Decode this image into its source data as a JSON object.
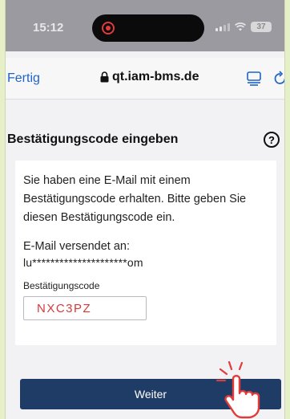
{
  "status_bar": {
    "time": "15:12",
    "battery": "37"
  },
  "browser": {
    "done_label": "Fertig",
    "url": "qt.iam-bms.de"
  },
  "section": {
    "title": "Bestätigungscode eingeben",
    "help_symbol": "?"
  },
  "card": {
    "info_text": "Sie haben eine E-Mail mit einem Bestätigungscode erhalten. Bitte geben Sie diesen Bestätigungscode ein.",
    "sent_label": "E-Mail versendet an:",
    "sent_email": "lu*********************om",
    "code_label": "Bestätigungscode",
    "code_value": "NXC3PZ"
  },
  "submit_label": "Weiter",
  "colors": {
    "accent_link": "#1f62c9",
    "button_bg": "#1f3c66",
    "code_text": "#d43a3a",
    "recording": "#e23b3b"
  },
  "icons": [
    "lock-icon",
    "reader-icon",
    "reload-icon",
    "help-icon",
    "recording-icon",
    "signal-icon",
    "wifi-icon",
    "battery-icon",
    "tap-hand-icon"
  ]
}
